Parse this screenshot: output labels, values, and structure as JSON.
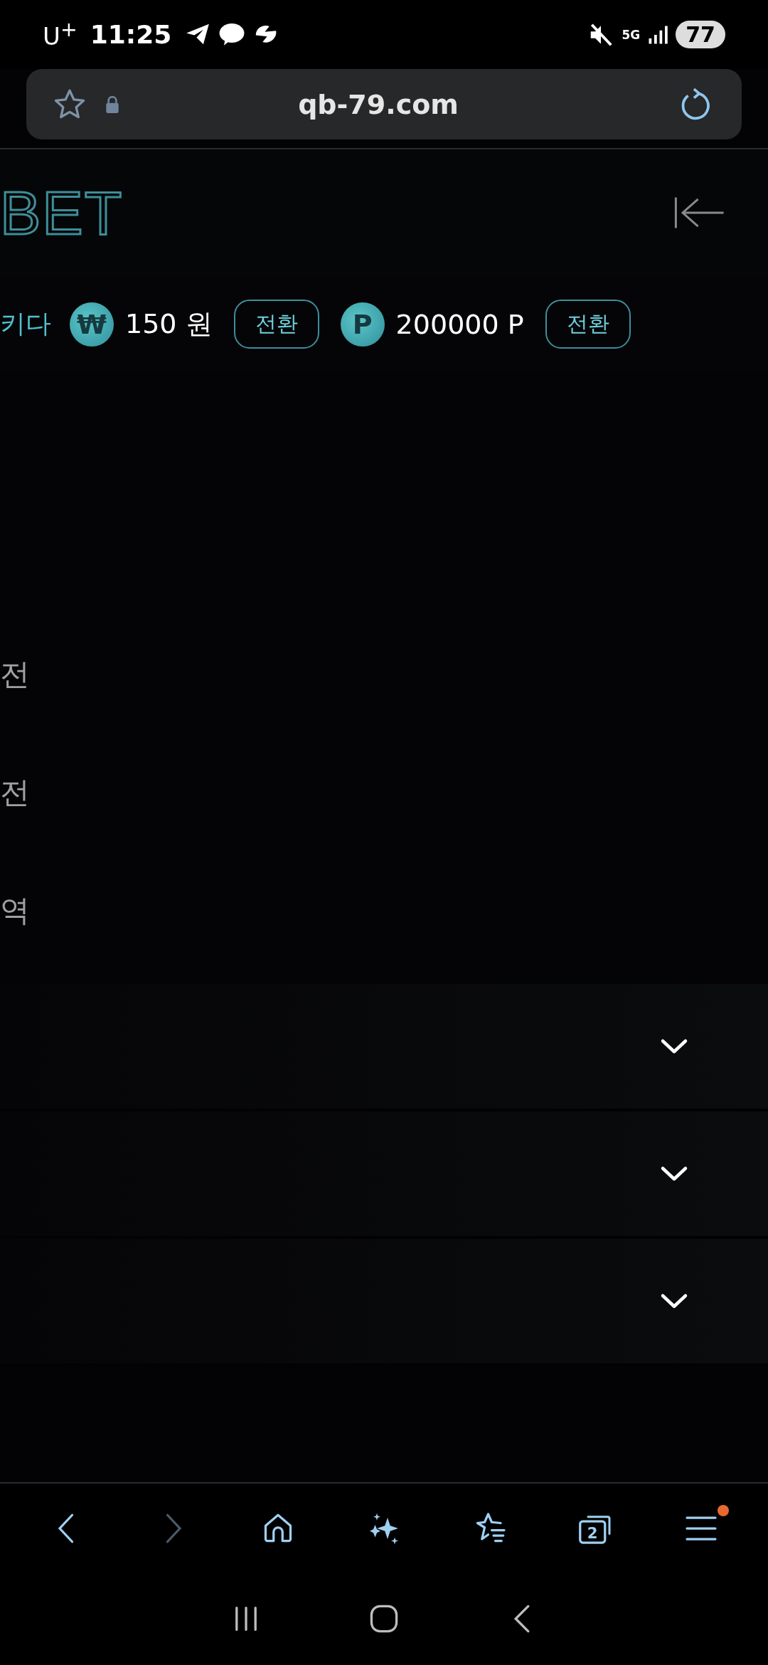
{
  "status_bar": {
    "carrier": "U$^{+}$",
    "time": "11:25",
    "network": "5G",
    "battery": "77"
  },
  "address_bar": {
    "url": "qb-79.com"
  },
  "header": {
    "logo": "BET"
  },
  "balance": {
    "name_fragment": "키다",
    "cash_symbol": "₩",
    "cash": "150 원",
    "cash_button": "전환",
    "points_symbol": "P",
    "points": "200000 P",
    "points_button": "전환"
  },
  "menu_items": [
    "전",
    "전",
    "역"
  ],
  "accordion": [
    {
      "expanded": false
    },
    {
      "expanded": false
    },
    {
      "expanded": false
    }
  ],
  "browser_nav": [
    {
      "kind": "back",
      "disabled": false
    },
    {
      "kind": "forward",
      "disabled": true
    },
    {
      "kind": "home",
      "disabled": false
    },
    {
      "kind": "sparkle",
      "disabled": false
    },
    {
      "kind": "bookmarks",
      "disabled": false
    },
    {
      "kind": "tabs",
      "disabled": false,
      "count": "2"
    },
    {
      "kind": "menu",
      "disabled": false,
      "badge": true
    }
  ]
}
